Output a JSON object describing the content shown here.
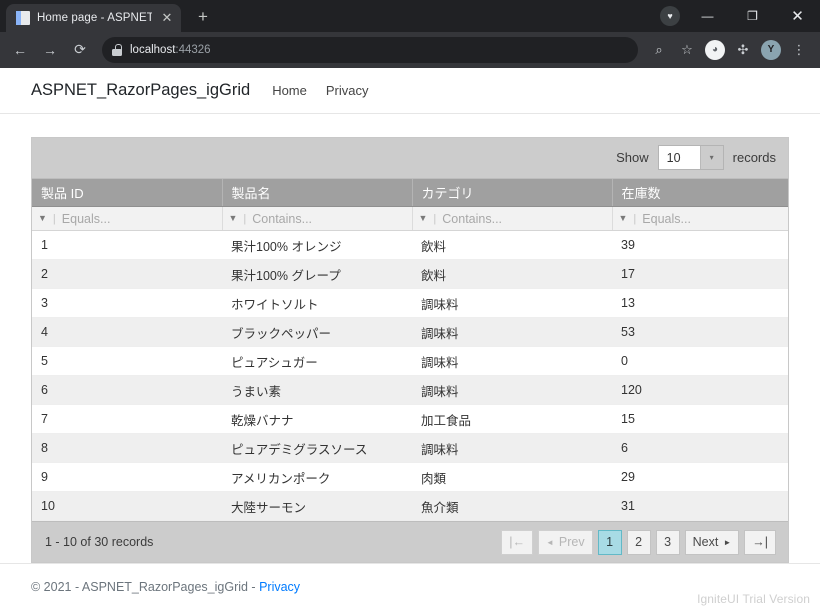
{
  "browser": {
    "tab": {
      "title": "Home page - ASPNET_RazorPag",
      "close_label": "✕",
      "favicon": "page-icon"
    },
    "new_tab_label": "+",
    "window_controls": {
      "minimize": "—",
      "maximize": "❐",
      "close": "✕"
    },
    "profile_badge": "♥",
    "nav": {
      "back": "←",
      "forward": "→",
      "reload": "⟳"
    },
    "omnibox": {
      "scheme_icon": "lock-icon",
      "host": "localhost",
      "port": ":44326"
    },
    "toolbar_right": {
      "zoom_search": "⌕",
      "bookmark": "☆",
      "extension_circle": "◕",
      "puzzle": "✣",
      "avatar_initial": "Y",
      "menu": "⋮"
    }
  },
  "site": {
    "brand": "ASPNET_RazorPages_igGrid",
    "nav_links": [
      "Home",
      "Privacy"
    ],
    "footer": {
      "copyright": "© 2021 - ASPNET_RazorPages_igGrid - ",
      "privacy_link": "Privacy"
    },
    "watermark": "IgniteUI Trial Version"
  },
  "grid": {
    "toolbar": {
      "show_label": "Show",
      "page_size": "10",
      "records_label": "records",
      "dropdown_arrow": "▾"
    },
    "columns": [
      {
        "header": "製品 ID",
        "filter_placeholder": "Equals...",
        "filter_icon": "▼"
      },
      {
        "header": "製品名",
        "filter_placeholder": "Contains...",
        "filter_icon": "▼"
      },
      {
        "header": "カテゴリ",
        "filter_placeholder": "Contains...",
        "filter_icon": "▼"
      },
      {
        "header": "在庫数",
        "filter_placeholder": "Equals...",
        "filter_icon": "▼"
      }
    ],
    "rows": [
      {
        "id": "1",
        "name": "果汁100% オレンジ",
        "category": "飲料",
        "stock": "39"
      },
      {
        "id": "2",
        "name": "果汁100% グレープ",
        "category": "飲料",
        "stock": "17"
      },
      {
        "id": "3",
        "name": "ホワイトソルト",
        "category": "調味料",
        "stock": "13"
      },
      {
        "id": "4",
        "name": "ブラックペッパー",
        "category": "調味料",
        "stock": "53"
      },
      {
        "id": "5",
        "name": "ピュアシュガー",
        "category": "調味料",
        "stock": "0"
      },
      {
        "id": "6",
        "name": "うまい素",
        "category": "調味料",
        "stock": "120"
      },
      {
        "id": "7",
        "name": "乾燥バナナ",
        "category": "加工食品",
        "stock": "15"
      },
      {
        "id": "8",
        "name": "ピュアデミグラスソース",
        "category": "調味料",
        "stock": "6"
      },
      {
        "id": "9",
        "name": "アメリカンポーク",
        "category": "肉類",
        "stock": "29"
      },
      {
        "id": "10",
        "name": "大陸サーモン",
        "category": "魚介類",
        "stock": "31"
      }
    ],
    "footer": {
      "info": "1 - 10 of 30 records",
      "first_icon": "|←",
      "prev_icon": "◄",
      "prev_label": "Prev",
      "pages": [
        "1",
        "2",
        "3"
      ],
      "active_page": "1",
      "next_label": "Next",
      "next_icon": "►",
      "last_icon": "→|"
    }
  },
  "colors": {
    "header_gray": "#a0a0a0",
    "toolbar_gray": "#cccccc",
    "active_page": "#a8dbe5",
    "link_blue": "#007bff"
  }
}
